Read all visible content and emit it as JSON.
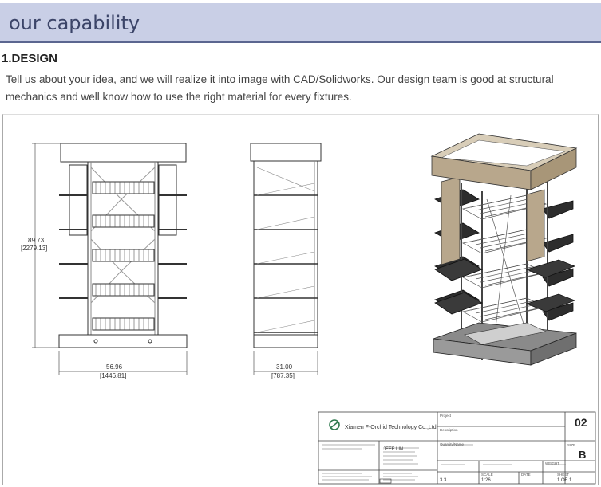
{
  "header": {
    "title": "our capability"
  },
  "section": {
    "heading": "1.DESIGN",
    "body": "Tell us about your idea, and we will realize it into image with CAD/Solidworks. Our design team is good at structural mechanics and well know how to use the right material for every fixtures."
  },
  "drawing": {
    "front_view": {
      "height_dim": "89.73",
      "height_dim_metric": "[2279.13]",
      "width_dim": "56.96",
      "width_dim_metric": "[1446.81]"
    },
    "side_view": {
      "width_dim": "31.00",
      "width_dim_metric": "[787.35]"
    },
    "title_block": {
      "company": "Xiamen F-Orchid Technology Co.,Ltd",
      "project_label": "Project",
      "description_label": "Description",
      "designer": "JEFF LIN",
      "quantity_label": "Quantity/Name",
      "revision": "02",
      "size_label": "SIZE",
      "size": "B",
      "scale_label": "SCALE",
      "scale": "1:26",
      "date_label": "DATE",
      "sheet_label": "SHEET",
      "sheet": "1 OF 1",
      "rev_value": "3.3",
      "weight_label": "WEIGHT"
    }
  }
}
